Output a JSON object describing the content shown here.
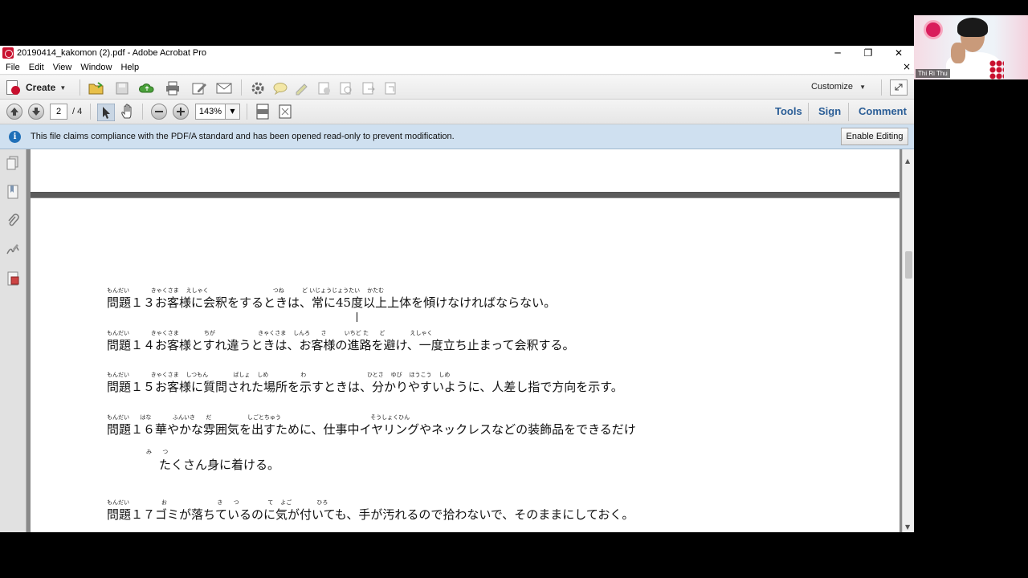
{
  "window": {
    "title": "20190414_kakomon (2).pdf - Adobe Acrobat Pro",
    "controls": {
      "minimize": "─",
      "restore": "❐",
      "close": "✕"
    }
  },
  "menu": {
    "items": [
      "File",
      "Edit",
      "View",
      "Window",
      "Help"
    ],
    "close": "×"
  },
  "toolbar": {
    "create_label": "Create",
    "customize_label": "Customize",
    "caret": "▼",
    "icons": [
      "open-folder-icon",
      "save-icon",
      "cloud-upload-icon",
      "print-icon",
      "edit-pencil-icon",
      "email-icon",
      "settings-gear-icon",
      "comment-bubble-icon",
      "highlight-icon",
      "stamp-icon",
      "attach-icon",
      "share-icon",
      "export-icon"
    ]
  },
  "nav": {
    "page_current": "2",
    "page_total": "/ 4",
    "zoom": "143%",
    "tools_label": "Tools",
    "sign_label": "Sign",
    "comment_label": "Comment"
  },
  "notice": {
    "icon": "i",
    "message": "This file claims compliance with the PDF/A standard and has been opened read-only to prevent modification.",
    "button_label": "Enable Editing"
  },
  "document": {
    "questions": [
      {
        "furigana": "もんだい            きゃくさま    えしゃく                                    つね          ど いじょうじょうたい    かたむ",
        "text": "問題１３お客様に会釈をするときは、常に45度以上上体を傾けなければならない。"
      },
      {
        "furigana": "もんだい            きゃくさま              ちが                        きゃくさま    しんろ      さ          いちど た      ど              えしゃく",
        "text": "問題１４お客様とすれ違うときは、お客様の進路を避け、一度立ち止まって会釈する。"
      },
      {
        "furigana": "もんだい            きゃくさま    しつもん              ばしょ    しめ                  わ                                  ひとさ    ゆび    ほうこう    しめ",
        "text": "問題１５お客様に質問された場所を示すときは、分かりやすいように、人差し指で方向を示す。"
      },
      {
        "furigana": "もんだい      はな            ふんいき      だ                    しごとちゅう                                                  そうしょくひん",
        "text": "問題１６華やかな雰囲気を出すために、仕事中イヤリングやネックレスなどの装飾品をできるだけ"
      },
      {
        "furigana": "                      み      つ",
        "text": "たくさん身に着ける。"
      },
      {
        "furigana": "もんだい                  お                            き      つ                て    よご              ひろ",
        "text": "問題１７ゴミが落ちているのに気が付いても、手が汚れるので拾わないで、そのままにしておく。"
      }
    ]
  },
  "webcam": {
    "participant_name": "Thi Ri Thu"
  }
}
